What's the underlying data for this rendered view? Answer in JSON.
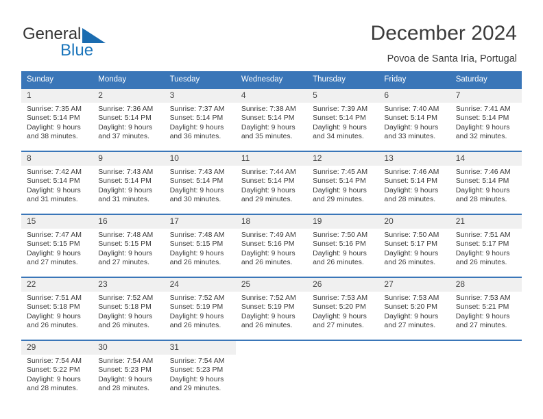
{
  "brand": {
    "name_part1": "General",
    "name_part2": "Blue",
    "accent_color": "#1b75bb",
    "triangle_icon": "triangle-icon"
  },
  "header": {
    "title": "December 2024",
    "subtitle": "Povoa de Santa Iria, Portugal"
  },
  "calendar": {
    "header_color": "#3a76b8",
    "weekdays": [
      "Sunday",
      "Monday",
      "Tuesday",
      "Wednesday",
      "Thursday",
      "Friday",
      "Saturday"
    ],
    "weeks": [
      [
        {
          "day": "1",
          "sunrise": "Sunrise: 7:35 AM",
          "sunset": "Sunset: 5:14 PM",
          "daylight_line1": "Daylight: 9 hours",
          "daylight_line2": "and 38 minutes."
        },
        {
          "day": "2",
          "sunrise": "Sunrise: 7:36 AM",
          "sunset": "Sunset: 5:14 PM",
          "daylight_line1": "Daylight: 9 hours",
          "daylight_line2": "and 37 minutes."
        },
        {
          "day": "3",
          "sunrise": "Sunrise: 7:37 AM",
          "sunset": "Sunset: 5:14 PM",
          "daylight_line1": "Daylight: 9 hours",
          "daylight_line2": "and 36 minutes."
        },
        {
          "day": "4",
          "sunrise": "Sunrise: 7:38 AM",
          "sunset": "Sunset: 5:14 PM",
          "daylight_line1": "Daylight: 9 hours",
          "daylight_line2": "and 35 minutes."
        },
        {
          "day": "5",
          "sunrise": "Sunrise: 7:39 AM",
          "sunset": "Sunset: 5:14 PM",
          "daylight_line1": "Daylight: 9 hours",
          "daylight_line2": "and 34 minutes."
        },
        {
          "day": "6",
          "sunrise": "Sunrise: 7:40 AM",
          "sunset": "Sunset: 5:14 PM",
          "daylight_line1": "Daylight: 9 hours",
          "daylight_line2": "and 33 minutes."
        },
        {
          "day": "7",
          "sunrise": "Sunrise: 7:41 AM",
          "sunset": "Sunset: 5:14 PM",
          "daylight_line1": "Daylight: 9 hours",
          "daylight_line2": "and 32 minutes."
        }
      ],
      [
        {
          "day": "8",
          "sunrise": "Sunrise: 7:42 AM",
          "sunset": "Sunset: 5:14 PM",
          "daylight_line1": "Daylight: 9 hours",
          "daylight_line2": "and 31 minutes."
        },
        {
          "day": "9",
          "sunrise": "Sunrise: 7:43 AM",
          "sunset": "Sunset: 5:14 PM",
          "daylight_line1": "Daylight: 9 hours",
          "daylight_line2": "and 31 minutes."
        },
        {
          "day": "10",
          "sunrise": "Sunrise: 7:43 AM",
          "sunset": "Sunset: 5:14 PM",
          "daylight_line1": "Daylight: 9 hours",
          "daylight_line2": "and 30 minutes."
        },
        {
          "day": "11",
          "sunrise": "Sunrise: 7:44 AM",
          "sunset": "Sunset: 5:14 PM",
          "daylight_line1": "Daylight: 9 hours",
          "daylight_line2": "and 29 minutes."
        },
        {
          "day": "12",
          "sunrise": "Sunrise: 7:45 AM",
          "sunset": "Sunset: 5:14 PM",
          "daylight_line1": "Daylight: 9 hours",
          "daylight_line2": "and 29 minutes."
        },
        {
          "day": "13",
          "sunrise": "Sunrise: 7:46 AM",
          "sunset": "Sunset: 5:14 PM",
          "daylight_line1": "Daylight: 9 hours",
          "daylight_line2": "and 28 minutes."
        },
        {
          "day": "14",
          "sunrise": "Sunrise: 7:46 AM",
          "sunset": "Sunset: 5:14 PM",
          "daylight_line1": "Daylight: 9 hours",
          "daylight_line2": "and 28 minutes."
        }
      ],
      [
        {
          "day": "15",
          "sunrise": "Sunrise: 7:47 AM",
          "sunset": "Sunset: 5:15 PM",
          "daylight_line1": "Daylight: 9 hours",
          "daylight_line2": "and 27 minutes."
        },
        {
          "day": "16",
          "sunrise": "Sunrise: 7:48 AM",
          "sunset": "Sunset: 5:15 PM",
          "daylight_line1": "Daylight: 9 hours",
          "daylight_line2": "and 27 minutes."
        },
        {
          "day": "17",
          "sunrise": "Sunrise: 7:48 AM",
          "sunset": "Sunset: 5:15 PM",
          "daylight_line1": "Daylight: 9 hours",
          "daylight_line2": "and 26 minutes."
        },
        {
          "day": "18",
          "sunrise": "Sunrise: 7:49 AM",
          "sunset": "Sunset: 5:16 PM",
          "daylight_line1": "Daylight: 9 hours",
          "daylight_line2": "and 26 minutes."
        },
        {
          "day": "19",
          "sunrise": "Sunrise: 7:50 AM",
          "sunset": "Sunset: 5:16 PM",
          "daylight_line1": "Daylight: 9 hours",
          "daylight_line2": "and 26 minutes."
        },
        {
          "day": "20",
          "sunrise": "Sunrise: 7:50 AM",
          "sunset": "Sunset: 5:17 PM",
          "daylight_line1": "Daylight: 9 hours",
          "daylight_line2": "and 26 minutes."
        },
        {
          "day": "21",
          "sunrise": "Sunrise: 7:51 AM",
          "sunset": "Sunset: 5:17 PM",
          "daylight_line1": "Daylight: 9 hours",
          "daylight_line2": "and 26 minutes."
        }
      ],
      [
        {
          "day": "22",
          "sunrise": "Sunrise: 7:51 AM",
          "sunset": "Sunset: 5:18 PM",
          "daylight_line1": "Daylight: 9 hours",
          "daylight_line2": "and 26 minutes."
        },
        {
          "day": "23",
          "sunrise": "Sunrise: 7:52 AM",
          "sunset": "Sunset: 5:18 PM",
          "daylight_line1": "Daylight: 9 hours",
          "daylight_line2": "and 26 minutes."
        },
        {
          "day": "24",
          "sunrise": "Sunrise: 7:52 AM",
          "sunset": "Sunset: 5:19 PM",
          "daylight_line1": "Daylight: 9 hours",
          "daylight_line2": "and 26 minutes."
        },
        {
          "day": "25",
          "sunrise": "Sunrise: 7:52 AM",
          "sunset": "Sunset: 5:19 PM",
          "daylight_line1": "Daylight: 9 hours",
          "daylight_line2": "and 26 minutes."
        },
        {
          "day": "26",
          "sunrise": "Sunrise: 7:53 AM",
          "sunset": "Sunset: 5:20 PM",
          "daylight_line1": "Daylight: 9 hours",
          "daylight_line2": "and 27 minutes."
        },
        {
          "day": "27",
          "sunrise": "Sunrise: 7:53 AM",
          "sunset": "Sunset: 5:20 PM",
          "daylight_line1": "Daylight: 9 hours",
          "daylight_line2": "and 27 minutes."
        },
        {
          "day": "28",
          "sunrise": "Sunrise: 7:53 AM",
          "sunset": "Sunset: 5:21 PM",
          "daylight_line1": "Daylight: 9 hours",
          "daylight_line2": "and 27 minutes."
        }
      ],
      [
        {
          "day": "29",
          "sunrise": "Sunrise: 7:54 AM",
          "sunset": "Sunset: 5:22 PM",
          "daylight_line1": "Daylight: 9 hours",
          "daylight_line2": "and 28 minutes."
        },
        {
          "day": "30",
          "sunrise": "Sunrise: 7:54 AM",
          "sunset": "Sunset: 5:23 PM",
          "daylight_line1": "Daylight: 9 hours",
          "daylight_line2": "and 28 minutes."
        },
        {
          "day": "31",
          "sunrise": "Sunrise: 7:54 AM",
          "sunset": "Sunset: 5:23 PM",
          "daylight_line1": "Daylight: 9 hours",
          "daylight_line2": "and 29 minutes."
        },
        null,
        null,
        null,
        null
      ]
    ]
  }
}
